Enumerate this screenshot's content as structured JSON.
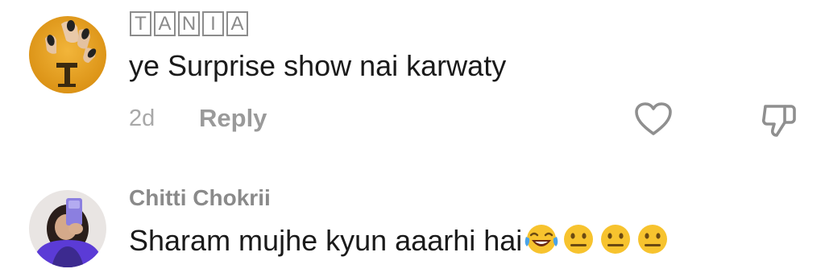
{
  "comments": [
    {
      "username_letters": [
        "T",
        "A",
        "N",
        "I",
        "A"
      ],
      "avatar": "letter-T-avatar",
      "text": "ye Surprise show nai karwaty",
      "time": "2d",
      "reply_label": "Reply",
      "like_icon": "heart-icon",
      "dislike_icon": "thumbs-down-icon"
    },
    {
      "username": "Chitti Chokrii",
      "avatar": "selfie-avatar",
      "text": "Sharam mujhe kyun aaarhi hai",
      "emojis": [
        "face-with-tears-of-joy-emoji",
        "neutral-face-emoji",
        "neutral-face-emoji",
        "neutral-face-emoji"
      ]
    }
  ],
  "colors": {
    "username": "#8a8a8a",
    "text": "#1a1a1a",
    "meta": "#a8a8a8",
    "emoji_yellow": "#f7c32e"
  }
}
